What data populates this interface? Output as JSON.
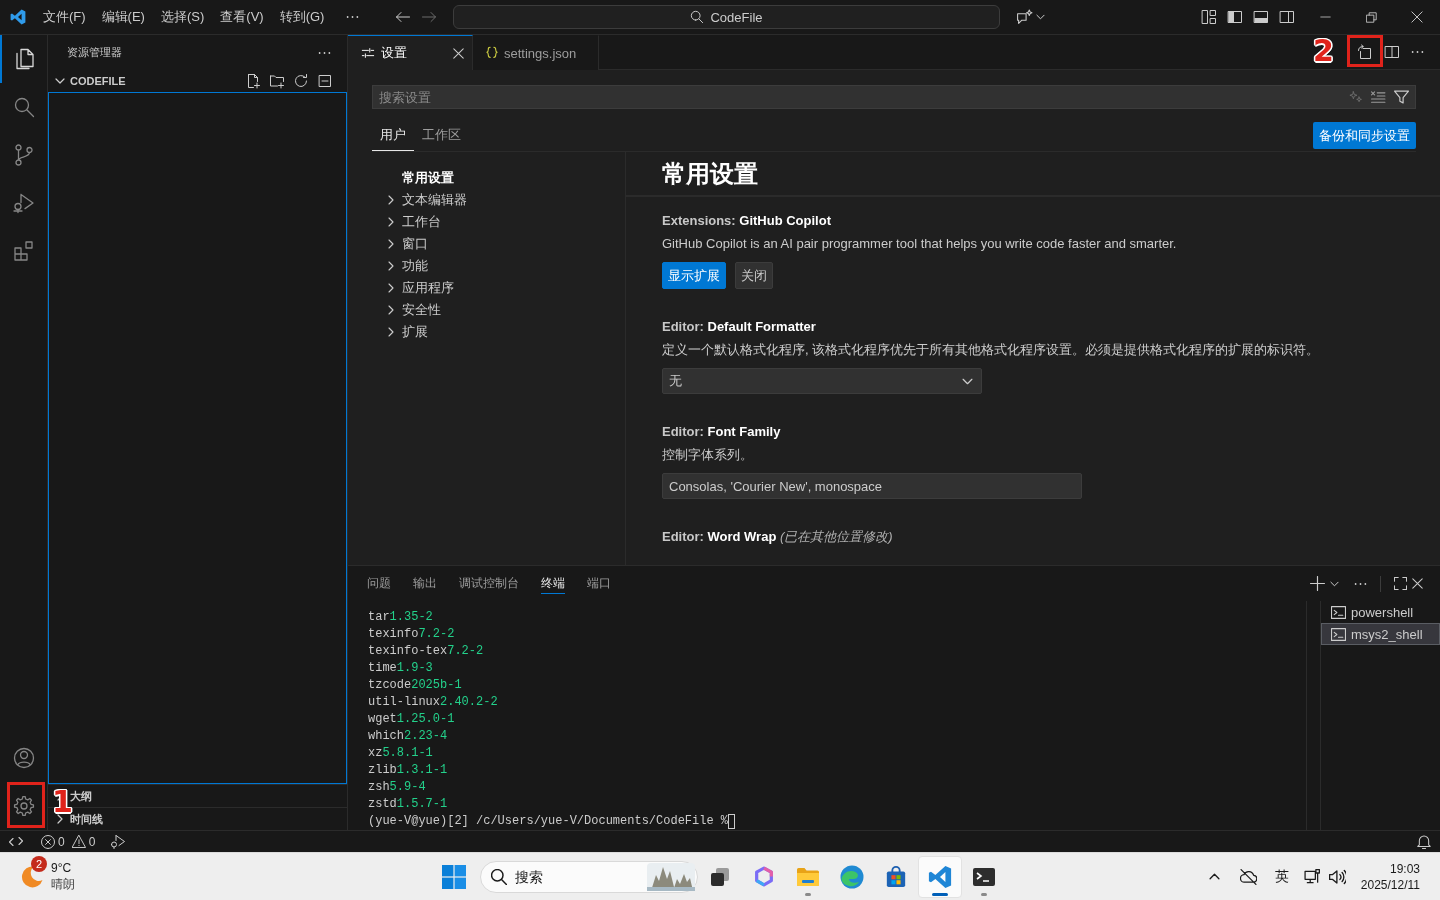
{
  "title_bar": {
    "menus": [
      "文件(F)",
      "编辑(E)",
      "选择(S)",
      "查看(V)",
      "转到(G)"
    ],
    "command_center": "CodeFile"
  },
  "activity_bar": {
    "top": [
      {
        "kind": "explorer",
        "selected": true
      },
      {
        "kind": "search",
        "selected": false
      },
      {
        "kind": "source-control",
        "selected": false
      },
      {
        "kind": "run",
        "selected": false
      },
      {
        "kind": "extensions",
        "selected": false
      }
    ],
    "bottom": [
      {
        "kind": "accounts"
      },
      {
        "kind": "manage",
        "callout": "1"
      }
    ]
  },
  "sidebar": {
    "title": "资源管理器",
    "sections": [
      {
        "kind": "folder",
        "title": "CODEFILE",
        "expanded": true,
        "focused": true
      },
      {
        "kind": "view",
        "title": "大纲",
        "expanded": false
      },
      {
        "kind": "view",
        "title": "时间线",
        "expanded": false
      }
    ]
  },
  "editor": {
    "tabs": [
      {
        "kind": "settings",
        "label": "设置",
        "selected": true
      },
      {
        "kind": "json",
        "label": "settings.json",
        "selected": false
      }
    ],
    "actions": [
      {
        "kind": "open-json",
        "callout": "2"
      },
      {
        "kind": "split"
      },
      {
        "kind": "more"
      }
    ]
  },
  "settings": {
    "search": {
      "placeholder": "搜索设置"
    },
    "scopes": [
      {
        "label": "用户",
        "selected": true
      },
      {
        "label": "工作区",
        "selected": false
      }
    ],
    "sync_button": "备份和同步设置",
    "toc": [
      {
        "label": "常用设置",
        "selected": true,
        "expandable": false
      },
      {
        "label": "文本编辑器",
        "selected": false,
        "expandable": true
      },
      {
        "label": "工作台",
        "selected": false,
        "expandable": true
      },
      {
        "label": "窗口",
        "selected": false,
        "expandable": true
      },
      {
        "label": "功能",
        "selected": false,
        "expandable": true
      },
      {
        "label": "应用程序",
        "selected": false,
        "expandable": true
      },
      {
        "label": "安全性",
        "selected": false,
        "expandable": true
      },
      {
        "label": "扩展",
        "selected": false,
        "expandable": true
      }
    ],
    "heading": "常用设置",
    "items": [
      {
        "kind": "buttons",
        "title": "Extensions: **GitHub Copilot**",
        "description": "GitHub Copilot is an AI pair programmer tool that helps you write code faster and smarter.",
        "buttons": [
          {
            "label": "显示扩展",
            "primary": true
          },
          {
            "label": "关闭",
            "primary": false
          }
        ]
      },
      {
        "kind": "dropdown",
        "title": "Editor: **Default Formatter**",
        "description": "定义一个默认格式化程序, 该格式化程序优先于所有其他格式化程序设置。必须是提供格式化程序的扩展的标识符。",
        "value": "无"
      },
      {
        "kind": "text",
        "title": "Editor: **Font Family**",
        "description": "控制字体系列。",
        "value": "Consolas, 'Courier New', monospace"
      },
      {
        "title": "Editor: **Word Wrap** *(已在其他位置修改)*"
      }
    ]
  },
  "panel": {
    "tabs": [
      {
        "label": "问题",
        "selected": false
      },
      {
        "label": "输出",
        "selected": false
      },
      {
        "label": "调试控制台",
        "selected": false
      },
      {
        "label": "终端",
        "selected": true
      },
      {
        "label": "端口",
        "selected": false
      }
    ],
    "terminal": {
      "lines": [
        {
          "name": "tar",
          "version": "1.35-2"
        },
        {
          "name": "texinfo",
          "version": "7.2-2"
        },
        {
          "name": "texinfo-tex",
          "version": "7.2-2"
        },
        {
          "name": "time",
          "version": "1.9-3"
        },
        {
          "name": "tzcode",
          "version": "2025b-1"
        },
        {
          "name": "util-linux",
          "version": "2.40.2-2"
        },
        {
          "name": "wget",
          "version": "1.25.0-1"
        },
        {
          "name": "which",
          "version": "2.23-4"
        },
        {
          "name": "xz",
          "version": "5.8.1-1"
        },
        {
          "name": "zlib",
          "version": "1.3.1-1"
        },
        {
          "name": "zsh",
          "version": "5.9-4"
        },
        {
          "name": "zstd",
          "version": "1.5.7-1"
        }
      ],
      "prompt": "(yue-V@yue)[2] /c/Users/yue-V/Documents/CodeFile %"
    },
    "terminals": [
      {
        "label": "powershell",
        "selected": false
      },
      {
        "label": "msys2_shell",
        "selected": true
      }
    ]
  },
  "status_bar": {
    "problems": [
      {
        "kind": "error",
        "count": "0"
      },
      {
        "kind": "warning",
        "count": "0"
      }
    ]
  },
  "taskbar": {
    "weather": {
      "badge": "2",
      "temperature": "9°C",
      "condition": "晴朗"
    },
    "search": {
      "placeholder": "搜索"
    },
    "apps": [
      {
        "kind": "task-view",
        "running": false,
        "active": false
      },
      {
        "kind": "assistant",
        "running": false,
        "active": false
      },
      {
        "kind": "files",
        "running": true,
        "active": false
      },
      {
        "kind": "browser",
        "running": false,
        "active": false
      },
      {
        "kind": "store",
        "running": false,
        "active": false
      },
      {
        "kind": "editor",
        "running": true,
        "active": true
      },
      {
        "kind": "terminal",
        "running": true,
        "active": false
      }
    ],
    "tray": {
      "language": "英"
    },
    "clock": {
      "time": "19:03",
      "date": "2025/12/11"
    }
  }
}
